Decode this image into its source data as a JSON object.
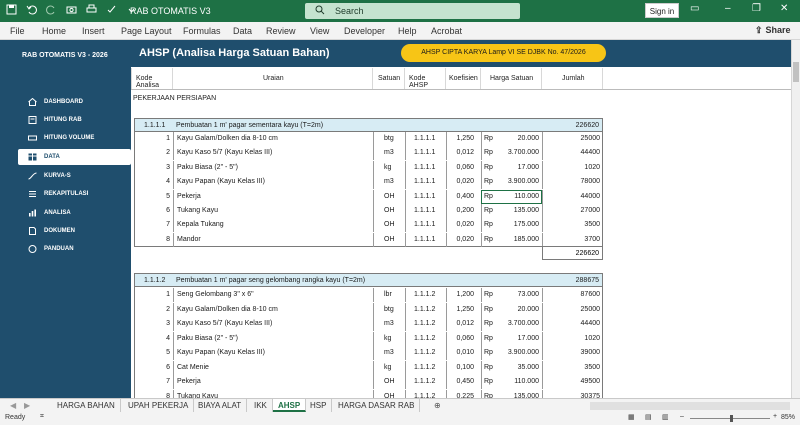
{
  "window": {
    "title": "RAB OTOMATIS V3",
    "search_placeholder": "Search",
    "sign_in": "Sign in"
  },
  "ribbon": {
    "tabs": [
      "File",
      "Home",
      "Insert",
      "Page Layout",
      "Formulas",
      "Data",
      "Review",
      "View",
      "Developer",
      "Help",
      "Acrobat"
    ],
    "share": "Share"
  },
  "sidebar": {
    "app_title": "RAB OTOMATIS V3 - 2026",
    "items": [
      {
        "label": "DASHBOARD",
        "icon": "home-icon"
      },
      {
        "label": "HITUNG RAB",
        "icon": "calculator-icon"
      },
      {
        "label": "HITUNG VOLUME",
        "icon": "ruler-icon"
      },
      {
        "label": "DATA",
        "icon": "database-icon",
        "active": true
      },
      {
        "label": "KURVA-S",
        "icon": "curve-icon"
      },
      {
        "label": "REKAPITULASI",
        "icon": "list-icon"
      },
      {
        "label": "ANALISA",
        "icon": "chart-icon"
      },
      {
        "label": "DOKUMEN",
        "icon": "document-icon"
      },
      {
        "label": "PANDUAN",
        "icon": "help-icon"
      }
    ]
  },
  "banner": {
    "title": "AHSP (Analisa Harga Satuan Bahan)",
    "pill": "AHSP CIPTA KARYA Lamp VI SE DJBK No. 47/2026"
  },
  "columns": [
    "Kode Analisa",
    "Uraian",
    "Satuan",
    "Kode AHSP",
    "Koefisien",
    "Harga Satuan",
    "Jumlah"
  ],
  "section_label": "PEKERJAAN PERSIAPAN",
  "groups": [
    {
      "code": "1.1.1.1",
      "title": "Pembuatan 1 m' pagar sementara kayu (T=2m)",
      "value": "226620",
      "total": "226620",
      "rows": [
        {
          "no": "1",
          "desc": "Kayu Galam/Dolken dia 8-10 cm",
          "unit": "btg",
          "code": "1.1.1.1",
          "coef": "1,250",
          "cur": "Rp",
          "price": "20.000",
          "amount": "25000"
        },
        {
          "no": "2",
          "desc": "Kayu Kaso 5/7 (Kayu Kelas III)",
          "unit": "m3",
          "code": "1.1.1.1",
          "coef": "0,012",
          "cur": "Rp",
          "price": "3.700.000",
          "amount": "44400"
        },
        {
          "no": "3",
          "desc": "Paku Biasa (2\" - 5\")",
          "unit": "kg",
          "code": "1.1.1.1",
          "coef": "0,060",
          "cur": "Rp",
          "price": "17.000",
          "amount": "1020"
        },
        {
          "no": "4",
          "desc": "Kayu Papan (Kayu Kelas III)",
          "unit": "m3",
          "code": "1.1.1.1",
          "coef": "0,020",
          "cur": "Rp",
          "price": "3.900.000",
          "amount": "78000"
        },
        {
          "no": "5",
          "desc": "Pekerja",
          "unit": "OH",
          "code": "1.1.1.1",
          "coef": "0,400",
          "cur": "Rp",
          "price": "110.000",
          "amount": "44000"
        },
        {
          "no": "6",
          "desc": "Tukang Kayu",
          "unit": "OH",
          "code": "1.1.1.1",
          "coef": "0,200",
          "cur": "Rp",
          "price": "135.000",
          "amount": "27000"
        },
        {
          "no": "7",
          "desc": "Kepala Tukang",
          "unit": "OH",
          "code": "1.1.1.1",
          "coef": "0,020",
          "cur": "Rp",
          "price": "175.000",
          "amount": "3500"
        },
        {
          "no": "8",
          "desc": "Mandor",
          "unit": "OH",
          "code": "1.1.1.1",
          "coef": "0,020",
          "cur": "Rp",
          "price": "185.000",
          "amount": "3700"
        }
      ]
    },
    {
      "code": "1.1.1.2",
      "title": "Pembuatan 1 m' pagar seng gelombang rangka kayu (T=2m)",
      "value": "288675",
      "rows": [
        {
          "no": "1",
          "desc": "Seng Gelombang 3\" x 6\"",
          "unit": "lbr",
          "code": "1.1.1.2",
          "coef": "1,200",
          "cur": "Rp",
          "price": "73.000",
          "amount": "87600"
        },
        {
          "no": "2",
          "desc": "Kayu Galam/Dolken dia 8-10 cm",
          "unit": "btg",
          "code": "1.1.1.2",
          "coef": "1,250",
          "cur": "Rp",
          "price": "20.000",
          "amount": "25000"
        },
        {
          "no": "3",
          "desc": "Kayu Kaso 5/7 (Kayu Kelas III)",
          "unit": "m3",
          "code": "1.1.1.2",
          "coef": "0,012",
          "cur": "Rp",
          "price": "3.700.000",
          "amount": "44400"
        },
        {
          "no": "4",
          "desc": "Paku Biasa (2\" - 5\")",
          "unit": "kg",
          "code": "1.1.1.2",
          "coef": "0,060",
          "cur": "Rp",
          "price": "17.000",
          "amount": "1020"
        },
        {
          "no": "5",
          "desc": "Kayu Papan (Kayu Kelas III)",
          "unit": "m3",
          "code": "1.1.1.2",
          "coef": "0,010",
          "cur": "Rp",
          "price": "3.900.000",
          "amount": "39000"
        },
        {
          "no": "6",
          "desc": "Cat Menie",
          "unit": "kg",
          "code": "1.1.1.2",
          "coef": "0,100",
          "cur": "Rp",
          "price": "35.000",
          "amount": "3500"
        },
        {
          "no": "7",
          "desc": "Pekerja",
          "unit": "OH",
          "code": "1.1.1.2",
          "coef": "0,450",
          "cur": "Rp",
          "price": "110.000",
          "amount": "49500"
        },
        {
          "no": "8",
          "desc": "Tukang Kayu",
          "unit": "OH",
          "code": "1.1.1.2",
          "coef": "0,225",
          "cur": "Rp",
          "price": "135.000",
          "amount": "30375"
        }
      ]
    }
  ],
  "sheets": [
    "HARGA BAHAN",
    "UPAH PEKERJA",
    "BIAYA ALAT",
    "IKK",
    "AHSP",
    "HSP",
    "HARGA DASAR RAB"
  ],
  "active_sheet": "AHSP",
  "status": {
    "ready": "Ready",
    "zoom": "85%"
  },
  "colors": {
    "excel_green": "#1e7145",
    "sidebar": "#1f4e6d",
    "group_fill": "#d7ecf4",
    "pill": "#f7c516"
  }
}
